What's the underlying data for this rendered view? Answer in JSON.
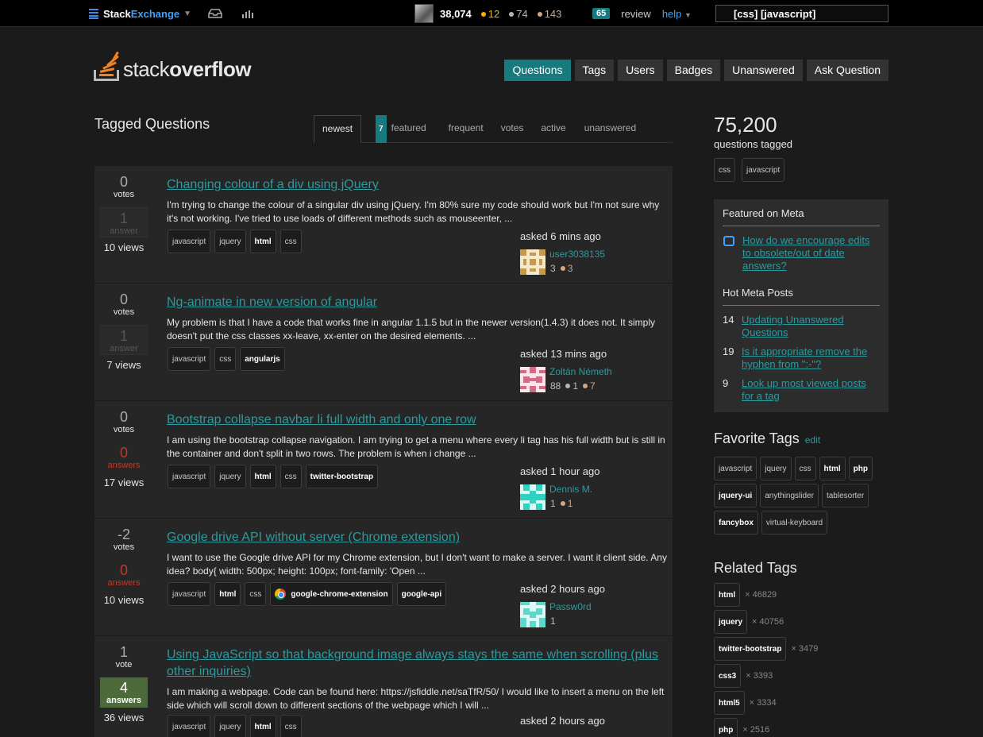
{
  "topbar": {
    "se_word1": "Stack",
    "se_word2": "Exchange",
    "reputation": "38,074",
    "badges": {
      "gold": "12",
      "silver": "74",
      "bronze": "143"
    },
    "review_count": "65",
    "review_label": "review",
    "help_label": "help",
    "search_value": "[css] [javascript]"
  },
  "header": {
    "logo_word1": "stack",
    "logo_word2": "overflow",
    "nav": [
      "Questions",
      "Tags",
      "Users",
      "Badges",
      "Unanswered",
      "Ask Question"
    ]
  },
  "page": {
    "title": "Tagged Questions",
    "tabs": [
      "newest",
      "featured",
      "frequent",
      "votes",
      "active",
      "unanswered"
    ],
    "featured_count": "7"
  },
  "questions": [
    {
      "votes": "0",
      "votes_label": "votes",
      "answers": "1",
      "answers_label": "answer",
      "views": "10 views",
      "title": "Changing colour of a div using jQuery",
      "excerpt": "I'm trying to change the colour of a singular div using jQuery. I'm 80% sure my code should work but I'm not sure why it's not working. I've tried to use loads of different methods such as mouseenter, ...",
      "tags": [
        "javascript",
        "jquery",
        "html",
        "css"
      ],
      "asked": "asked 6 mins ago",
      "user": "user3038135",
      "rep": "3",
      "b_silver": "",
      "b_bronze": "3"
    },
    {
      "votes": "0",
      "votes_label": "votes",
      "answers": "1",
      "answers_label": "answer",
      "views": "7 views",
      "title": "Ng-animate in new version of angular",
      "excerpt": "My problem is that I have a code that works fine in angular 1.1.5 but in the newer version(1.4.3) it does not. It simply doesn't put the css classes xx-leave, xx-enter on the desired elements. ...",
      "tags": [
        "javascript",
        "css",
        "angularjs"
      ],
      "asked": "asked 13 mins ago",
      "user": "Zoltán Németh",
      "rep": "88",
      "b_silver": "1",
      "b_bronze": "7"
    },
    {
      "votes": "0",
      "votes_label": "votes",
      "answers": "0",
      "answers_label": "answers",
      "views": "17 views",
      "title": "Bootstrap collapse navbar li full width and only one row",
      "excerpt": "I am using the bootstrap collapse navigation. I am trying to get a menu where every li tag has his full width but is still in the container and don't split in two rows. The problem is when i change ...",
      "tags": [
        "javascript",
        "jquery",
        "html",
        "css",
        "twitter-bootstrap"
      ],
      "asked": "asked 1 hour ago",
      "user": "Dennis M.",
      "rep": "1",
      "b_silver": "",
      "b_bronze": "1"
    },
    {
      "votes": "-2",
      "votes_label": "votes",
      "answers": "0",
      "answers_label": "answers",
      "views": "10 views",
      "title": "Google drive API without server (Chrome extension)",
      "excerpt": "I want to use the Google drive API for my Chrome extension, but I don't want to make a server. I want it client side. Any idea? body{ width: 500px; height: 100px; font-family: 'Open ...",
      "tags": [
        "javascript",
        "html",
        "css",
        "google-chrome-extension",
        "google-api"
      ],
      "asked": "asked 2 hours ago",
      "user": "Passw0rd",
      "rep": "1",
      "b_silver": "",
      "b_bronze": ""
    },
    {
      "votes": "1",
      "votes_label": "vote",
      "answers": "4",
      "answers_label": "answers",
      "views": "36 views",
      "title": "Using JavaScript so that background image always stays the same when scrolling (plus other inquiries)",
      "excerpt": "I am making a webpage. Code can be found here: https://jsfiddle.net/saTfR/50/ I would like to insert a menu on the left side which will scroll down to different sections of the webpage which I will ...",
      "tags": [
        "javascript",
        "jquery",
        "html",
        "css"
      ],
      "asked": "asked 2 hours ago",
      "user": "",
      "rep": "",
      "b_silver": "",
      "b_bronze": ""
    }
  ],
  "sidebar": {
    "count": "75,200",
    "count_label": "questions tagged",
    "tags": [
      "css",
      "javascript"
    ],
    "featured_meta_title": "Featured on Meta",
    "featured_meta": [
      {
        "title": "How do we encourage edits to obsolete/out of date answers?"
      }
    ],
    "hot_meta_title": "Hot Meta Posts",
    "hot_meta": [
      {
        "num": "14",
        "title": "Updating Unanswered Questions"
      },
      {
        "num": "19",
        "title": "Is it appropriate remove the hyphen from \":-\"?"
      },
      {
        "num": "9",
        "title": "Look up most viewed posts for a tag"
      }
    ],
    "fav_title": "Favorite Tags",
    "fav_edit": "edit",
    "fav_tags": [
      "javascript",
      "jquery",
      "css",
      "html",
      "php",
      "jquery-ui",
      "anythingslider",
      "tablesorter",
      "fancybox",
      "virtual-keyboard"
    ],
    "related_title": "Related Tags",
    "related": [
      {
        "tag": "html",
        "count": "× 46829"
      },
      {
        "tag": "jquery",
        "count": "× 40756"
      },
      {
        "tag": "twitter-bootstrap",
        "count": "× 3479"
      },
      {
        "tag": "css3",
        "count": "× 3393"
      },
      {
        "tag": "html5",
        "count": "× 3334"
      },
      {
        "tag": "php",
        "count": "× 2516"
      }
    ]
  }
}
